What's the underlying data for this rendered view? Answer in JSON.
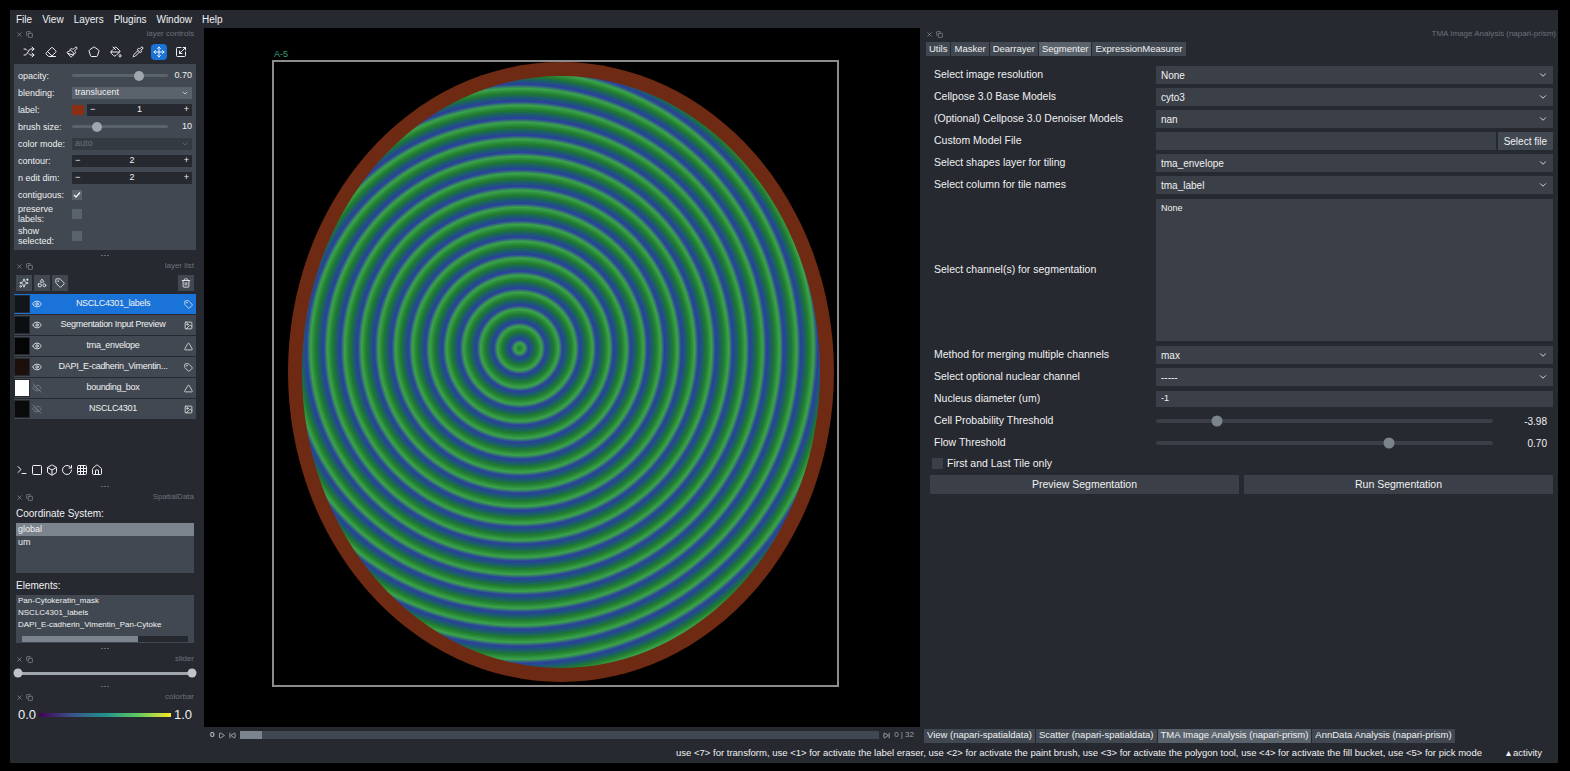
{
  "menu": [
    "File",
    "View",
    "Layers",
    "Plugins",
    "Window",
    "Help"
  ],
  "handle": "···",
  "layer_controls": {
    "title": "layer controls",
    "tools": [
      {
        "selected": false
      },
      {
        "selected": false
      },
      {
        "selected": false
      },
      {
        "selected": false
      },
      {
        "selected": false
      },
      {
        "selected": false
      },
      {
        "selected": true
      },
      {
        "selected": false
      }
    ],
    "rows": [
      {
        "kind": "slider",
        "label": "opacity:",
        "value": "0.70",
        "level": 0.7
      },
      {
        "kind": "dropdown",
        "label": "blending:",
        "value": "translucent",
        "disabled": false
      },
      {
        "kind": "label",
        "label": "label:",
        "value": "1",
        "minus": "−",
        "plus": "+",
        "color": "#8b2e12"
      },
      {
        "kind": "slider",
        "label": "brush size:",
        "value": "10",
        "level": 0.26
      },
      {
        "kind": "dropdown",
        "label": "color mode:",
        "value": "auto",
        "disabled": true
      },
      {
        "kind": "spin",
        "label": "contour:",
        "value": "2",
        "minus": "−",
        "plus": "+"
      },
      {
        "kind": "spin",
        "label": "n edit dim:",
        "value": "2",
        "minus": "−",
        "plus": "+"
      },
      {
        "kind": "checkbox",
        "label": "contiguous:",
        "checked": true
      },
      {
        "kind": "checkbox",
        "label": "preserve labels:",
        "checked": false
      },
      {
        "kind": "checkbox",
        "label": "show selected:",
        "checked": false
      }
    ]
  },
  "layer_list": {
    "title": "layer list",
    "layers": [
      {
        "name": "NSCLC4301_labels",
        "kind": "labels",
        "visible": true,
        "selected": true,
        "color": "#10161a"
      },
      {
        "name": "Segmentation Input Preview",
        "kind": "image",
        "visible": true,
        "selected": false,
        "color": "#0c0f12"
      },
      {
        "name": "tma_envelope",
        "kind": "shapes",
        "visible": true,
        "selected": false,
        "color": "#050505"
      },
      {
        "name": "DAPI_E-cadherin_Vimentin...",
        "kind": "labels",
        "visible": true,
        "selected": false,
        "color": "#1c0f0c"
      },
      {
        "name": "bounding_box",
        "kind": "shapes",
        "visible": false,
        "selected": false,
        "color": "#ffffff"
      },
      {
        "name": "NSCLC4301",
        "kind": "image",
        "visible": false,
        "selected": false,
        "color": "#0a0a0a"
      }
    ]
  },
  "spatialdata": {
    "title": "SpatialData",
    "coordinate_label": "Coordinate System:",
    "coordinate_systems": [
      {
        "name": "global",
        "selected": true
      },
      {
        "name": "um",
        "selected": false
      }
    ],
    "elements_label": "Elements:",
    "elements": [
      {
        "name": "Pan-Cytokeratin_mask",
        "selected": false
      },
      {
        "name": "NSCLC4301_labels",
        "selected": false
      },
      {
        "name": "DAPI_E-cadherin_Vimentin_Pan-Cytoke",
        "selected": false
      }
    ]
  },
  "slider": {
    "title": "slider",
    "level_low": 0,
    "level_high": 1
  },
  "colorbar": {
    "title": "colorbar",
    "min": "0.0",
    "max": "1.0"
  },
  "canvas": {
    "tile_label": "A-5",
    "dims_start": "0",
    "dims_end": "0 | 32",
    "level": 0
  },
  "dock": {
    "title": "TMA Image Analysis (napari-prism)",
    "tabs": [
      {
        "label": "Utils",
        "selected": false
      },
      {
        "label": "Masker",
        "selected": false
      },
      {
        "label": "Dearrayer",
        "selected": false
      },
      {
        "label": "Segmenter",
        "selected": true
      },
      {
        "label": "ExpressionMeasurer",
        "selected": false
      }
    ],
    "fields": [
      {
        "kind": "dropdown",
        "label": "Select image resolution",
        "value": "None"
      },
      {
        "kind": "dropdown",
        "label": "Cellpose 3.0 Base Models",
        "value": "cyto3"
      },
      {
        "kind": "dropdown",
        "label": "(Optional) Cellpose 3.0 Denoiser Models",
        "value": "nan"
      },
      {
        "kind": "file",
        "label": "Custom Model File",
        "value": "",
        "button": "Select file"
      },
      {
        "kind": "dropdown",
        "label": "Select shapes layer for tiling",
        "value": "tma_envelope"
      },
      {
        "kind": "dropdown",
        "label": "Select column for tile names",
        "value": "tma_label"
      },
      {
        "kind": "listbox",
        "label": "Select channel(s) for segmentation",
        "value": "None"
      },
      {
        "kind": "dropdown",
        "label": "Method for merging multiple channels",
        "value": "max"
      },
      {
        "kind": "dropdown",
        "label": "Select optional nuclear channel",
        "value": "-----"
      },
      {
        "kind": "text",
        "label": "Nucleus diameter (um)",
        "value": "-1"
      },
      {
        "kind": "slider",
        "label": "Cell Probability Threshold",
        "value": "-3.98",
        "level": 0.18
      },
      {
        "kind": "slider",
        "label": "Flow Threshold",
        "value": "0.70",
        "level": 0.69
      },
      {
        "kind": "checkbox",
        "label": "First and Last Tile only",
        "checked": false
      }
    ],
    "buttons": [
      "Preview Segmentation",
      "Run Segmentation"
    ]
  },
  "bottom_tabs": [
    {
      "label": "View (napari-spatialdata)",
      "selected": false
    },
    {
      "label": "Scatter (napari-spatialdata)",
      "selected": false
    },
    {
      "label": "TMA Image Analysis (napari-prism)",
      "selected": true
    },
    {
      "label": "AnnData Analysis (napari-prism)",
      "selected": false
    }
  ],
  "status_bar": {
    "hint": "use <7> for transform, use <1> for activate the label eraser, use <2> for activate the paint brush, use <3> for activate the polygon tool, use <4> for activate the fill bucket, use <5> for pick mode",
    "activity_icon": "▴",
    "activity": "activity"
  }
}
